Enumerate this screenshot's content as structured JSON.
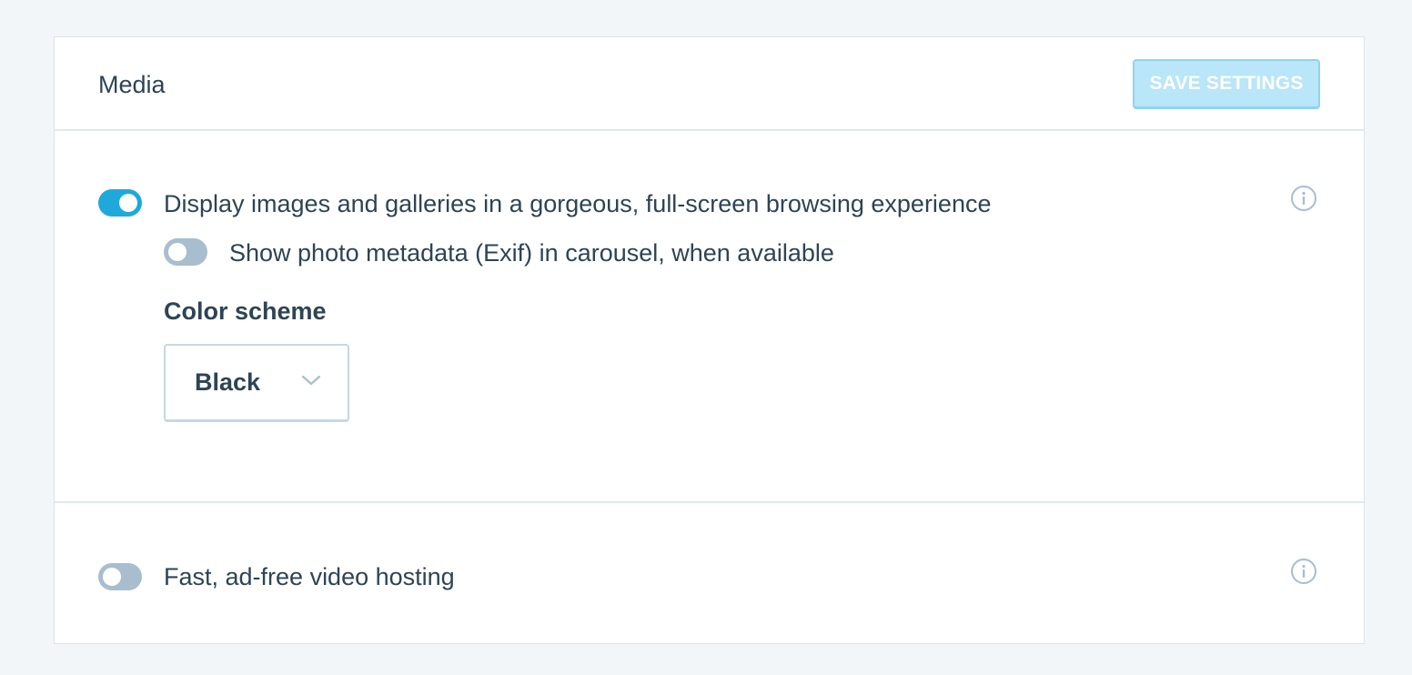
{
  "header": {
    "title": "Media",
    "save_label": "SAVE SETTINGS"
  },
  "carousel": {
    "toggle_state": "on",
    "label": "Display images and galleries in a gorgeous, full-screen browsing experience",
    "exif": {
      "toggle_state": "off",
      "label": "Show photo metadata (Exif) in carousel, when available"
    },
    "color_scheme": {
      "label": "Color scheme",
      "selected": "Black"
    }
  },
  "video": {
    "toggle_state": "off",
    "label": "Fast, ad-free video hosting"
  },
  "colors": {
    "accent": "#1fa9db",
    "toggle_off": "#a8bece",
    "button_disabled_bg": "#b9e6f8",
    "text": "#2e4453"
  },
  "icons": {
    "info": "info-icon",
    "chevron": "chevron-down-icon"
  }
}
